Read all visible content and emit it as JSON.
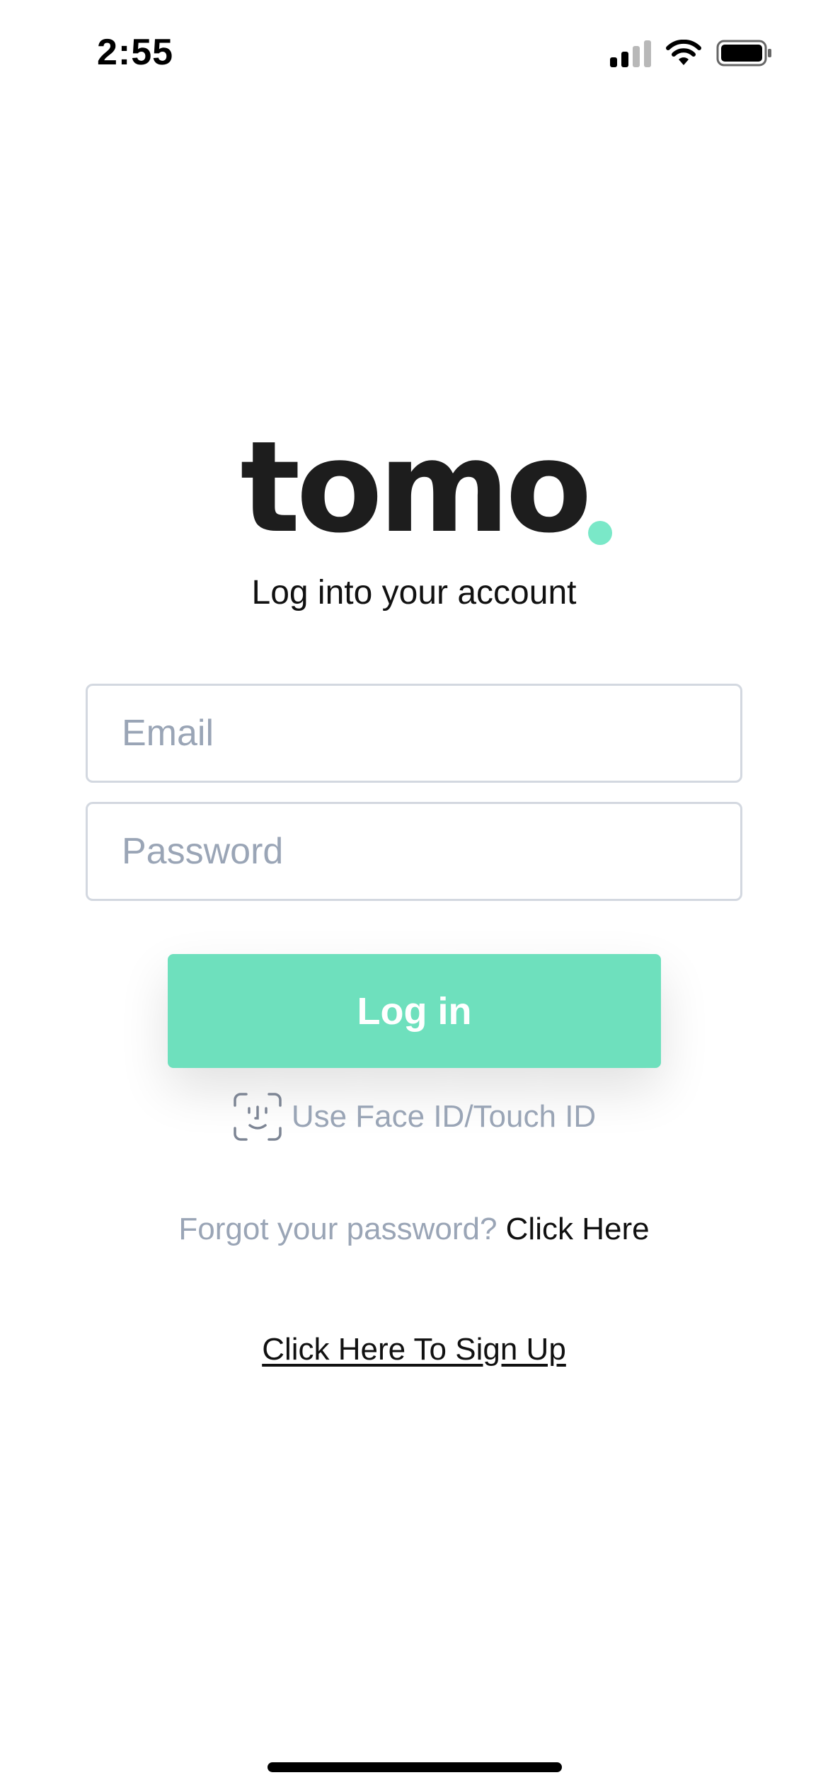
{
  "status_bar": {
    "time": "2:55",
    "signal_icon": "cellular-signal-icon",
    "wifi_icon": "wifi-icon",
    "battery_icon": "battery-icon"
  },
  "logo": {
    "text": "tomo",
    "dot_color": "#7ae8c8",
    "text_color": "#1d1d1d"
  },
  "subtitle": "Log into your account",
  "email": {
    "placeholder": "Email",
    "value": ""
  },
  "password": {
    "placeholder": "Password",
    "value": ""
  },
  "login_button": {
    "label": "Log in",
    "color": "#6ee0bd"
  },
  "biometric": {
    "label": "Use Face ID/Touch ID",
    "icon": "face-id-icon"
  },
  "forgot": {
    "text": "Forgot your password?",
    "link": "Click Here"
  },
  "signup": {
    "link": "Click Here To Sign Up"
  }
}
